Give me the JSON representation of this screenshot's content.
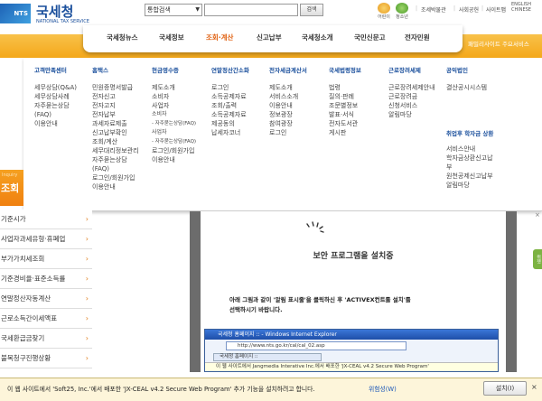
{
  "header": {
    "logo_mark": "NTS",
    "logo_title": "국세청",
    "logo_subtitle": "NATIONAL TAX SERVICE",
    "search_select": "통합검색",
    "search_button": "검색",
    "icons": [
      {
        "name": "kids-icon",
        "label": "어린이"
      },
      {
        "name": "youth-icon",
        "label": "청소년"
      }
    ],
    "links": [
      "조세박물관",
      "사회공헌",
      "사이트맵"
    ],
    "language": "ENGLISH CHINESE"
  },
  "gnb": {
    "items": [
      "국세청뉴스",
      "국세정보",
      "조회·계산",
      "신고납부",
      "국세청소개",
      "국민신문고",
      "전자민원"
    ],
    "active_index": 2,
    "family_site": "패밀리사이트 주요서비스"
  },
  "mega": {
    "columns": [
      {
        "head": "고객만족센터",
        "items": [
          "세무상담(Q&A)",
          "세무상담사례",
          "자주묻는상담",
          "(FAQ)",
          "이용안내"
        ]
      },
      {
        "head": "홈택스",
        "items": [
          "민원증명서발급",
          "전자신고",
          "전자고지",
          "전자납부",
          "과세자료제출",
          "신고납부확인",
          "조회/계산",
          "세무대리정보관리",
          "자주묻는상담",
          "(FAQ)",
          "로그인/회원가입",
          "이용안내"
        ]
      },
      {
        "head": "현금영수증",
        "items": [
          "제도소개",
          "소비자",
          "사업자",
          "소비자",
          "- 자주묻는상담(FAQ)",
          "사업자",
          "- 자주묻는상담(FAQ)",
          "로그인/회원가입",
          "이용안내"
        ]
      },
      {
        "head": "연말정산간소화",
        "items": [
          "로그인",
          "소득공제자료",
          "조회/출력",
          "소득공제자료",
          "제공동의",
          "납세자코너"
        ]
      },
      {
        "head": "전자세금계산서",
        "items": [
          "제도소개",
          "서비스소개",
          "이용안내",
          "정보광장",
          "참여광장",
          "로그인"
        ]
      },
      {
        "head": "국세법령정보",
        "items": [
          "법령",
          "질의·판례",
          "조문별정보",
          "발표·서식",
          "전자도서관",
          "게시판"
        ]
      },
      {
        "head": "근로장려세제",
        "items": [
          "근로장려세제안내",
          "근로장려금",
          "신청서비스",
          "알림마당"
        ]
      },
      {
        "head": "공익법인",
        "items": [
          "결산공시시스템"
        ]
      }
    ],
    "extra_head": "취업후 학자금 상환",
    "extra_items": [
      "서비스안내",
      "학자금상환신고납",
      "부",
      "원천공제신고납부",
      "알림마당"
    ]
  },
  "left": {
    "inquiry_small": "Inquiry",
    "inquiry_big": "조회",
    "menu": [
      "기준시가",
      "사업자과세유형·휴폐업",
      "부가가치세조회",
      "기준경비율·표준소득률",
      "연말정산자동계산",
      "근로소득간이세액표",
      "국세환급금찾기",
      "불복청구진행상황"
    ]
  },
  "installer": {
    "title": "보안 프로그램을 설치중",
    "desc_line1": "아래 그림과 같이 '알림 표시줄'을 클릭하신 후 'ACTIVEX컨트롤 설치'를",
    "desc_line2": "선택하시기 바랍니다.",
    "ie_title": "국세청 홈페이지 :: - Windows Internet Explorer",
    "ie_address": "http://www.nts.go.kr/cal/cal_02.asp",
    "ie_tab": "국세청 홈페이지 ::",
    "ie_bar": "이 웹 사이트에서 Jangmedia Interative Inc.에서 배포한 'JX-CEAL v4.2 Secure Web Program'"
  },
  "right_tab": "위젯",
  "notification": {
    "text": "이 웹 사이트에서 'Soft25, Inc.'에서 배포한 'JX-CEAL v4.2 Secure Web Program' 추가 기능을 설치하려고 합니다.",
    "help_link": "위험성(W)",
    "install_button": "설치(I)",
    "close": "×"
  }
}
